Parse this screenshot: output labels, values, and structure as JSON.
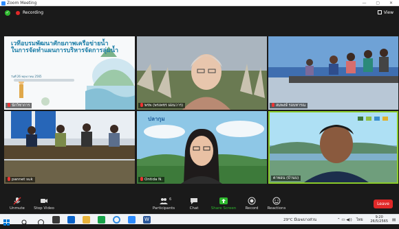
{
  "window": {
    "title": "Zoom Meeting",
    "controls": "— ▢ ✕"
  },
  "meeting": {
    "recording_label": "Recording",
    "view_label": "View"
  },
  "slide": {
    "title_line1": "เวทีอบรมพัฒนาศักยภาพเครือข่ายน้ำ",
    "title_line2": "ในการจัดทำแผนการบริหารจัดการลุ่มน้ำ",
    "date_text": "วันที่ 26 พฤษภาคม 2565"
  },
  "participants": [
    {
      "name": "นักวิชาการ",
      "muted": true
    },
    {
      "name": "พรพ (พรเพชร ผ่อนวาร)",
      "muted": true
    },
    {
      "name": "สมพงษ์ รอบทารณ",
      "muted": true
    },
    {
      "name": "pannet suk",
      "muted": true
    },
    {
      "name": "Ontida N.",
      "muted": true
    },
    {
      "name": "ตาพ่อน (บ้านบ)",
      "muted": false
    }
  ],
  "toolbar": {
    "unmute": "Unmute",
    "stop_video": "Stop Video",
    "participants": "Participants",
    "participants_count": "6",
    "chat": "Chat",
    "share_screen": "Share Screen",
    "record": "Record",
    "reactions": "Reactions",
    "leave": "Leave"
  },
  "taskbar": {
    "weather": "29°C มีเมฆบางส่วน",
    "lang": "ไทย",
    "time": "9:20",
    "date": "26/5/2565"
  },
  "colors": {
    "accent": "#2d8cff",
    "record": "#e02828",
    "share": "#2eb82e",
    "speaker_border": "#8ccc2a"
  }
}
